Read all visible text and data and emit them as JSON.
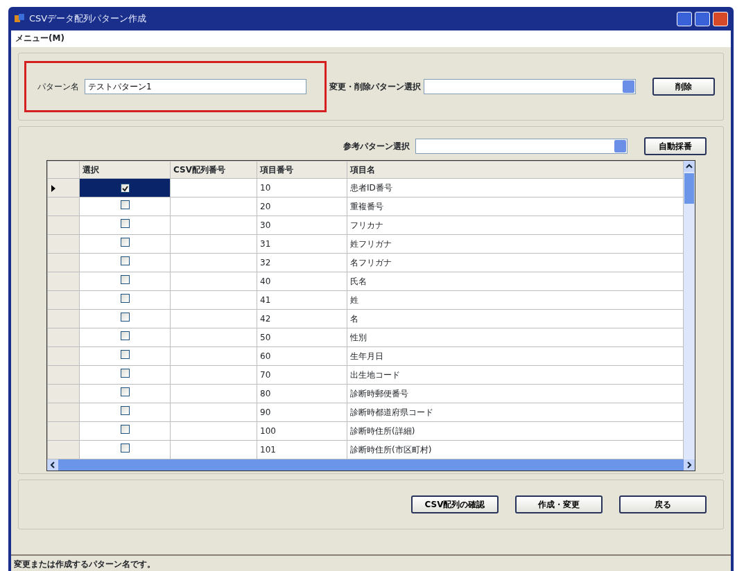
{
  "window": {
    "title": "CSVデータ配列パターン作成"
  },
  "menu": [
    {
      "label": "メニュー(M)"
    }
  ],
  "pattern_group": {
    "label": "パターン名",
    "value": "テストパターン1",
    "select_label": "変更・削除パターン選択",
    "delete_button": "削除"
  },
  "reference": {
    "label": "参考パターン選択",
    "button": "自動採番"
  },
  "table": {
    "columns": [
      "選択",
      "CSV配列番号",
      "項目番号",
      "項目名"
    ],
    "rows": [
      {
        "checked": true,
        "selected": true,
        "csv": "",
        "number": "10",
        "name": "患者ID番号"
      },
      {
        "checked": false,
        "selected": false,
        "csv": "",
        "number": "20",
        "name": "重複番号"
      },
      {
        "checked": false,
        "selected": false,
        "csv": "",
        "number": "30",
        "name": "フリカナ"
      },
      {
        "checked": false,
        "selected": false,
        "csv": "",
        "number": "31",
        "name": "姓フリガナ"
      },
      {
        "checked": false,
        "selected": false,
        "csv": "",
        "number": "32",
        "name": "名フリガナ"
      },
      {
        "checked": false,
        "selected": false,
        "csv": "",
        "number": "40",
        "name": "氏名"
      },
      {
        "checked": false,
        "selected": false,
        "csv": "",
        "number": "41",
        "name": "姓"
      },
      {
        "checked": false,
        "selected": false,
        "csv": "",
        "number": "42",
        "name": "名"
      },
      {
        "checked": false,
        "selected": false,
        "csv": "",
        "number": "50",
        "name": "性別"
      },
      {
        "checked": false,
        "selected": false,
        "csv": "",
        "number": "60",
        "name": "生年月日"
      },
      {
        "checked": false,
        "selected": false,
        "csv": "",
        "number": "70",
        "name": "出生地コード"
      },
      {
        "checked": false,
        "selected": false,
        "csv": "",
        "number": "80",
        "name": "診断時郵便番号"
      },
      {
        "checked": false,
        "selected": false,
        "csv": "",
        "number": "90",
        "name": "診断時都道府県コード"
      },
      {
        "checked": false,
        "selected": false,
        "csv": "",
        "number": "100",
        "name": "診断時住所(詳細)"
      },
      {
        "checked": false,
        "selected": false,
        "csv": "",
        "number": "101",
        "name": "診断時住所(市区町村)"
      }
    ]
  },
  "buttons": [
    "CSV配列の確認",
    "作成・変更",
    "戻る"
  ],
  "status_bar": "変更または作成するパターン名です。"
}
